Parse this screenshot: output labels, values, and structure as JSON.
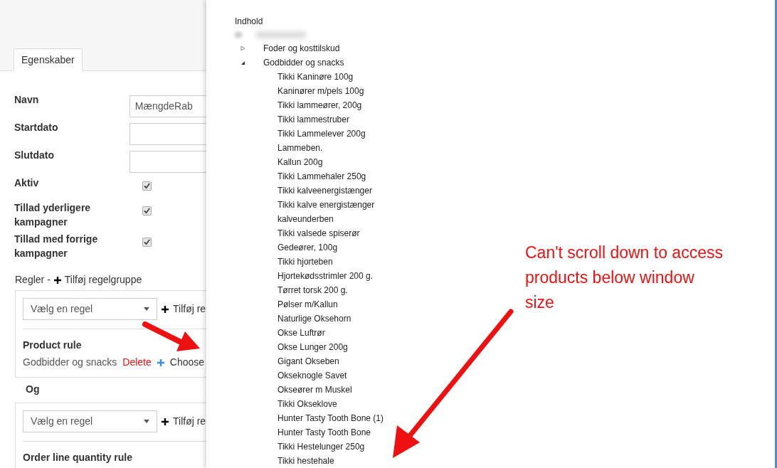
{
  "tab": {
    "label": "Egenskaber",
    "selected": true
  },
  "form": [
    {
      "kind": "text",
      "label": "Navn",
      "value": "MængdeRab"
    },
    {
      "kind": "text",
      "label": "Startdato"
    },
    {
      "kind": "text",
      "label": "Slutdato"
    },
    {
      "kind": "checkbox",
      "label": "Aktiv",
      "checked": true
    },
    {
      "kind": "checkbox",
      "label": "Tillad yderligere kampagner",
      "checked": true
    },
    {
      "kind": "checkbox",
      "label": "Tillad med forrige kampagner",
      "checked": true
    }
  ],
  "rules": {
    "title": "Regler -",
    "add_group": "Tilføj regelgruppe",
    "connector": "Og",
    "groups": [
      {
        "select_placeholder": "Vælg en regel",
        "add_rule": "Tilføj re",
        "rules": [
          {
            "name": "Product rule",
            "value": "Godbidder og snacks",
            "delete": "Delete",
            "choose": "Choose"
          }
        ]
      },
      {
        "select_placeholder": "Vælg en regel",
        "add_rule": "Tilføj re",
        "rules": [
          {
            "name": "Order line quantity rule"
          }
        ]
      }
    ]
  },
  "picker": {
    "title": "Indhold",
    "tree": [
      {
        "label": "Foder og kosttilskud",
        "expanded": false
      },
      {
        "label": "Godbidder og snacks",
        "expanded": true,
        "children": [
          {
            "label": "Tikki Kaninøre 100g"
          },
          {
            "label": "Kaninører m/pels 100g"
          },
          {
            "label": "Tikki lammeører, 200g"
          },
          {
            "label": "Tikki lammestruber"
          },
          {
            "label": "Tikki Lammelever 200g"
          },
          {
            "label": "Lammeben."
          },
          {
            "label": "Kallun 200g"
          },
          {
            "label": "Tikki Lammehaler 250g"
          },
          {
            "label": "Tikki kalveenergistænger"
          },
          {
            "label": "Tikki kalve energistænger"
          },
          {
            "label": "kalveunderben"
          },
          {
            "label": "Tikki valsede spiserør"
          },
          {
            "label": "Gedeører, 100g"
          },
          {
            "label": "Tikki hjorteben"
          },
          {
            "label": "Hjortekødsstrimler 200 g."
          },
          {
            "label": "Tørret torsk 200 g."
          },
          {
            "label": "Pølser m/Kallun"
          },
          {
            "label": "Naturlige Oksehorn"
          },
          {
            "label": "Okse Luftrør"
          },
          {
            "label": "Okse Lunger 200g"
          },
          {
            "label": "Gigant Okseben"
          },
          {
            "label": "Okseknogle Savet"
          },
          {
            "label": "Okseører m Muskel"
          },
          {
            "label": "Tikki Okseklove"
          },
          {
            "label": "Hunter Tasty Tooth Bone (1)"
          },
          {
            "label": "Hunter Tasty Tooth Bone"
          },
          {
            "label": "Tikki Hestelunger 250g"
          },
          {
            "label": "Tikki hestehale"
          }
        ]
      }
    ]
  },
  "annotation": {
    "lines": [
      "Can't scroll down to access",
      "products below window",
      "size"
    ]
  }
}
